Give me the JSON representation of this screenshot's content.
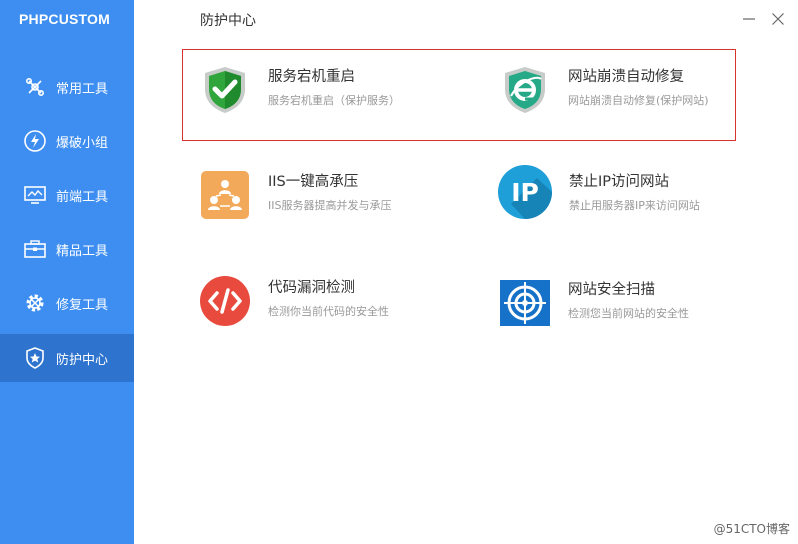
{
  "app": {
    "title": "PHPCUSTOM"
  },
  "sidebar": {
    "items": [
      {
        "label": "常用工具",
        "icon": "tools-icon"
      },
      {
        "label": "爆破小组",
        "icon": "lightning-icon"
      },
      {
        "label": "前端工具",
        "icon": "monitor-icon"
      },
      {
        "label": "精品工具",
        "icon": "toolbox-icon"
      },
      {
        "label": "修复工具",
        "icon": "gear-icon"
      },
      {
        "label": "防护中心",
        "icon": "shield-star-icon"
      }
    ],
    "active_index": 5
  },
  "header": {
    "title": "防护中心",
    "minimize": "minimize-icon",
    "close": "close-icon"
  },
  "cards": [
    {
      "name": "服务宕机重启",
      "desc": "服务宕机重启（保护服务）",
      "icon": "shield-check-icon"
    },
    {
      "name": "网站崩溃自动修复",
      "desc": "网站崩溃自动修复(保护网站)",
      "icon": "ie-shield-icon"
    },
    {
      "name": "IIS一键高承压",
      "desc": "IIS服务器提高并发与承压",
      "icon": "network-users-icon"
    },
    {
      "name": "禁止IP访问网站",
      "desc": "禁止用服务器IP来访问网站",
      "icon": "ip-badge-icon"
    },
    {
      "name": "代码漏洞检测",
      "desc": "检测你当前代码的安全性",
      "icon": "code-icon"
    },
    {
      "name": "网站安全扫描",
      "desc": "检测您当前网站的安全性",
      "icon": "target-icon"
    }
  ],
  "colors": {
    "sidebar": "#3d8ef0",
    "active": "#2e74cf",
    "highlight_border": "#d9342b"
  },
  "watermark": "@51CTO博客"
}
